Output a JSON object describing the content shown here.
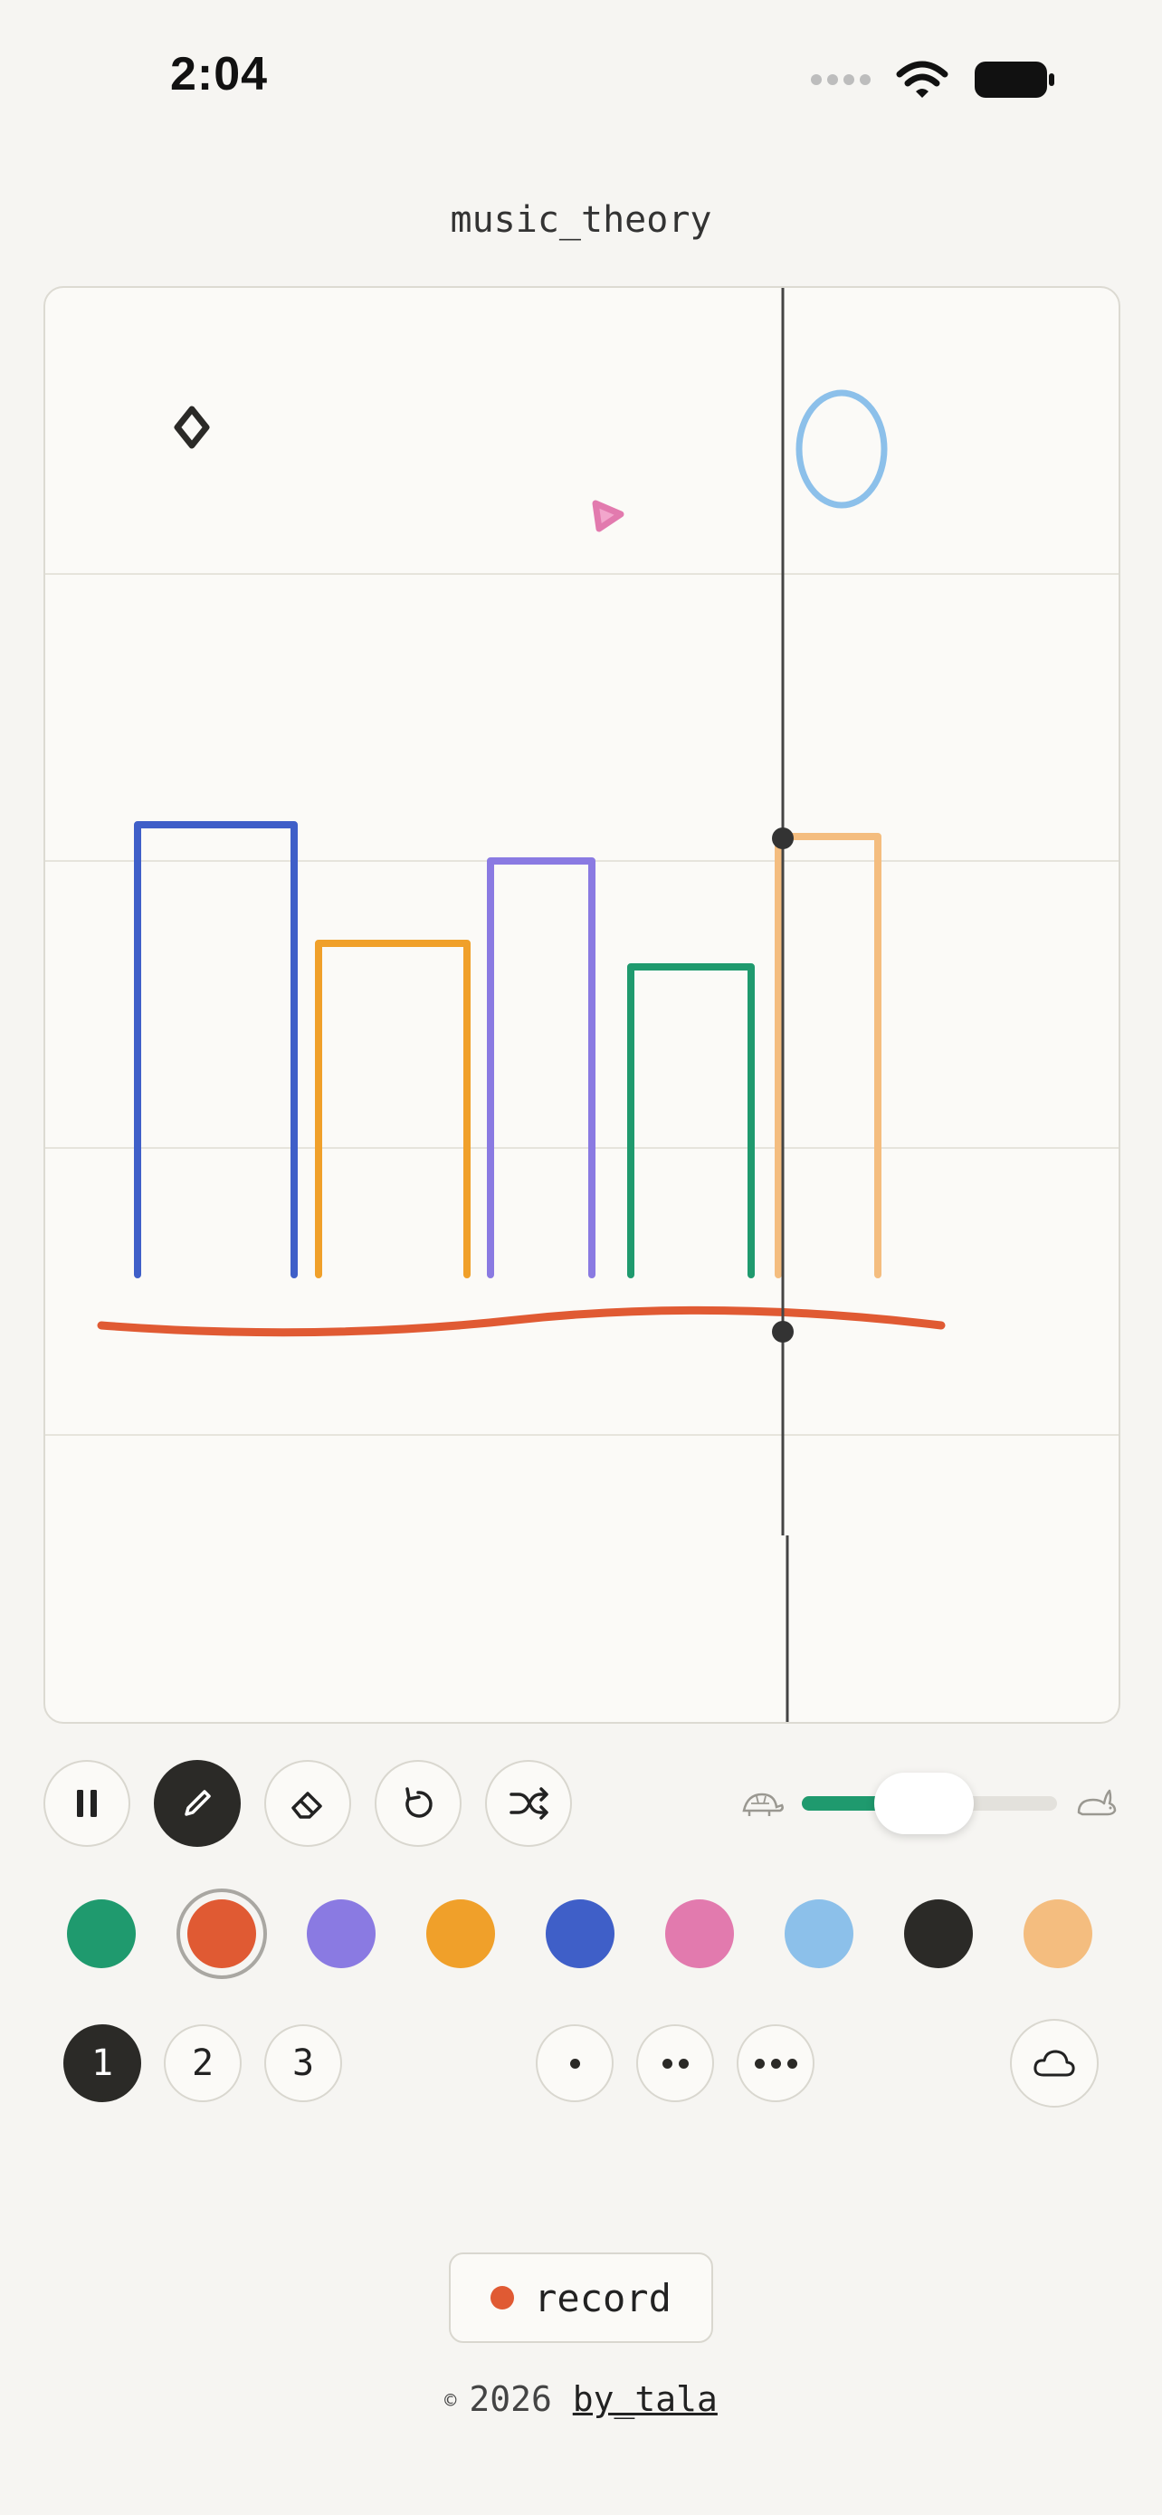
{
  "status_bar": {
    "time": "2:04"
  },
  "document": {
    "title": "music_theory"
  },
  "toolbar": {
    "tools": [
      {
        "name": "pause",
        "icon": "pause-icon",
        "active": false
      },
      {
        "name": "draw",
        "icon": "pencil-icon",
        "active": true
      },
      {
        "name": "erase",
        "icon": "eraser-icon",
        "active": false
      },
      {
        "name": "undo",
        "icon": "undo-icon",
        "active": false
      },
      {
        "name": "shuffle",
        "icon": "shuffle-icon",
        "active": false
      }
    ],
    "tempo": {
      "slow_icon": "turtle-icon",
      "fast_icon": "rabbit-icon",
      "value": 0.48
    }
  },
  "palette": {
    "selected": "#e05a33",
    "colors": [
      "#1f9a6e",
      "#e05a33",
      "#8a7ae2",
      "#f0a02a",
      "#3f5fc8",
      "#e27aae",
      "#8cc0ea",
      "#2b2a27",
      "#f4bd7f"
    ]
  },
  "layers": {
    "items": [
      "1",
      "2",
      "3"
    ],
    "active": "1"
  },
  "brush_sizes": [
    "small",
    "medium",
    "large"
  ],
  "cloud": {
    "icon": "cloud-icon"
  },
  "record": {
    "label": "record",
    "dot_color": "#e05a33"
  },
  "footer": {
    "copyright": "©",
    "year": "2026",
    "author": "by_tala"
  }
}
